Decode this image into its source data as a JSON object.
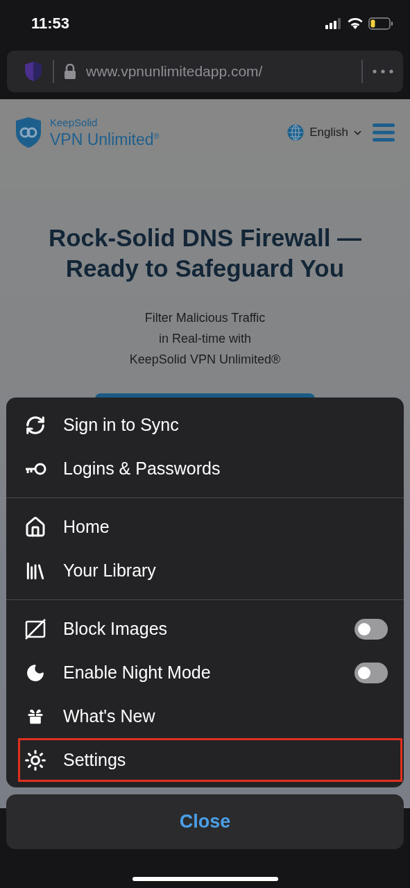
{
  "status_bar": {
    "time": "11:53"
  },
  "url_bar": {
    "url": "www.vpnunlimitedapp.com/"
  },
  "page": {
    "logo": {
      "brand": "KeepSolid",
      "product": "VPN Unlimited",
      "mark": "®"
    },
    "language": "English",
    "headline_lines": [
      "Rock-Solid DNS Firewall —",
      "Ready to Safeguard You"
    ],
    "subtitle_lines": [
      "Filter Malicious Traffic",
      "in Real-time with",
      "KeepSolid VPN Unlimited®"
    ]
  },
  "menu": {
    "groups": [
      {
        "items": [
          {
            "label": "Sign in to Sync",
            "kind": "link",
            "highlighted": false
          },
          {
            "label": "Logins & Passwords",
            "kind": "link",
            "highlighted": false
          }
        ]
      },
      {
        "items": [
          {
            "label": "Home",
            "kind": "link",
            "highlighted": false
          },
          {
            "label": "Your Library",
            "kind": "link",
            "highlighted": false
          }
        ]
      },
      {
        "items": [
          {
            "label": "Block Images",
            "kind": "toggle",
            "on": false,
            "highlighted": false
          },
          {
            "label": "Enable Night Mode",
            "kind": "toggle",
            "on": false,
            "highlighted": false
          },
          {
            "label": "What's New",
            "kind": "link",
            "highlighted": false
          },
          {
            "label": "Settings",
            "kind": "link",
            "highlighted": true
          }
        ]
      }
    ]
  },
  "close_button": "Close"
}
